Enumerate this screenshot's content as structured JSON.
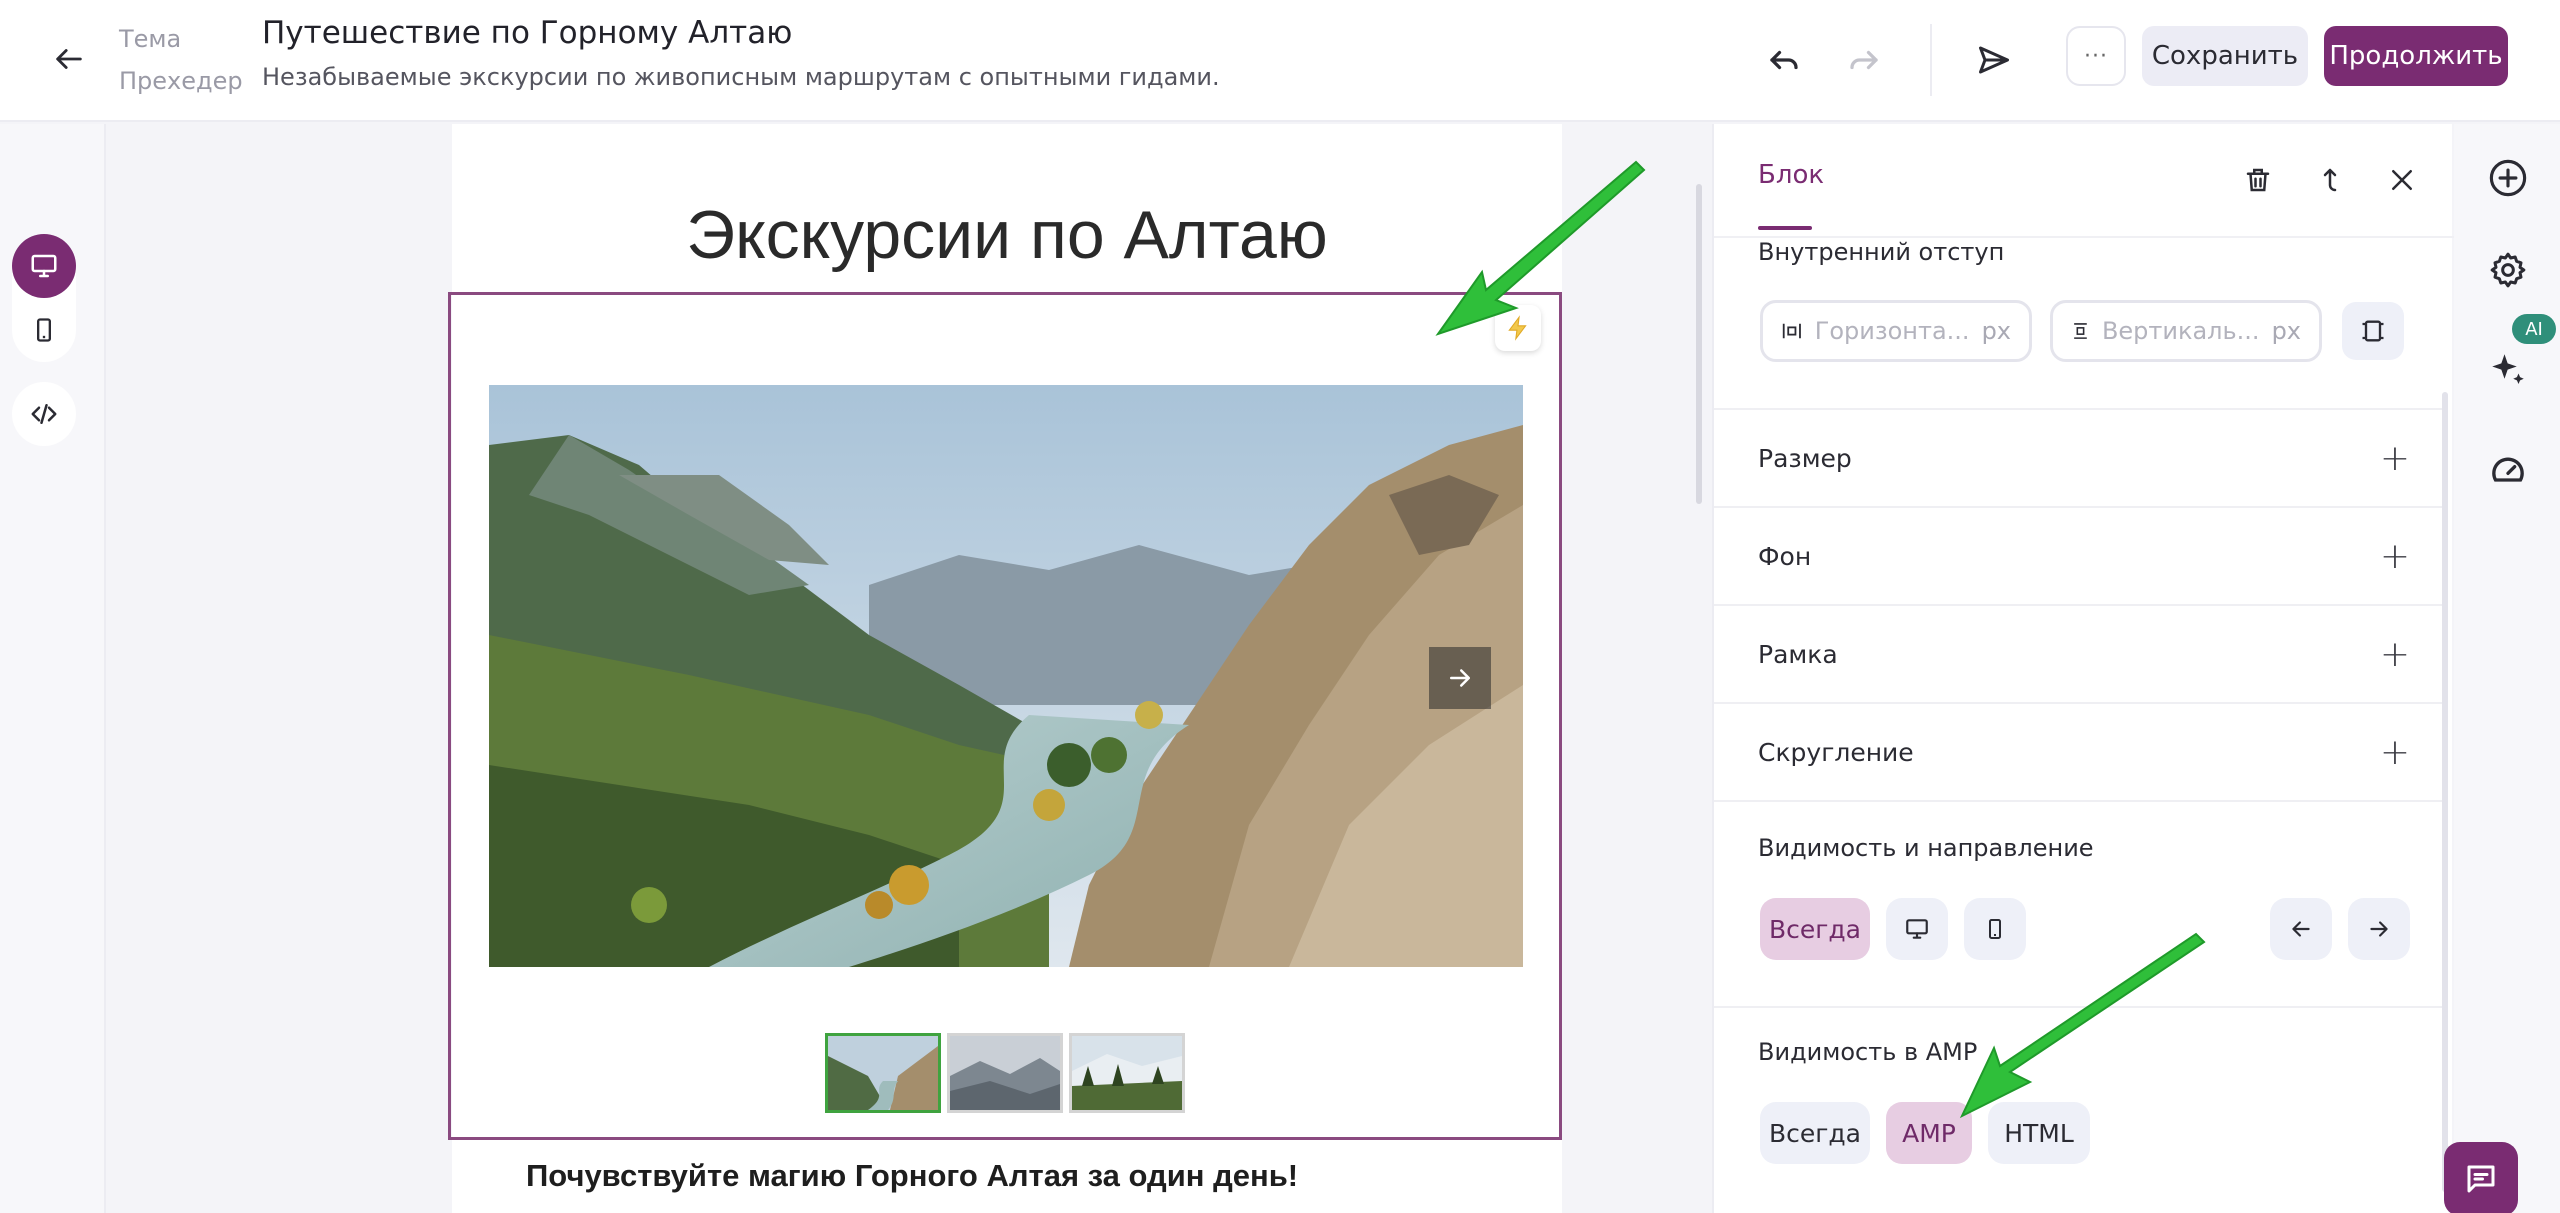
{
  "header": {
    "label_theme": "Тема",
    "label_preheader": "Прехедер",
    "title": "Путешествие по Горному Алтаю",
    "preheader": "Незабываемые экскурсии по живописным маршрутам с опытными гидами.",
    "more_label": "···",
    "save_label": "Сохранить",
    "continue_label": "Продолжить"
  },
  "email": {
    "heading": "Экскурсии по Алтаю",
    "subheading": "Почувствуйте магию Горного Алтая за один день!",
    "thumbnails": 3,
    "active_thumbnail": 1
  },
  "panel": {
    "tab": "Блок",
    "padding_label": "Внутренний отступ",
    "horizontal_placeholder": "Горизонта...",
    "vertical_placeholder": "Вертикаль...",
    "unit": "px",
    "accordion": [
      "Размер",
      "Фон",
      "Рамка",
      "Скругление"
    ],
    "visibility_label": "Видимость и направление",
    "visibility_always": "Всегда",
    "amp_label": "Видимость в AMP",
    "amp_options": [
      "Всегда",
      "AMP",
      "HTML"
    ],
    "amp_active": "AMP"
  },
  "rail": {
    "ai_badge": "AI"
  },
  "colors": {
    "brand": "#7a2c72",
    "brand_soft": "#e7cde2",
    "annotation": "#2fbf3a"
  }
}
